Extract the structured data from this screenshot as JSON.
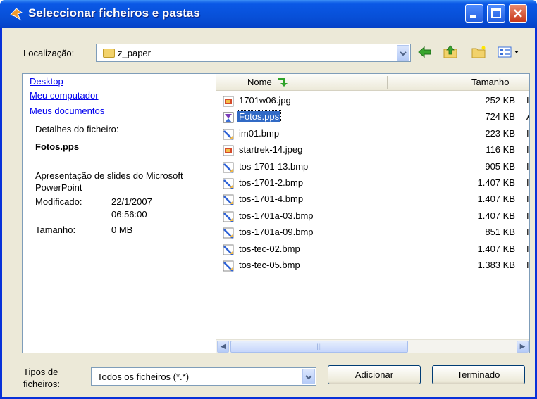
{
  "window": {
    "title": "Seleccionar ficheiros e pastas"
  },
  "location": {
    "label": "Localização:",
    "value": "z_paper"
  },
  "places": [
    "Desktop",
    "Meu computador",
    "Meus documentos"
  ],
  "details": {
    "heading": "Detalhes do ficheiro:",
    "file_name": "Fotos.pps",
    "type_line1": "Apresentação de slides do Microsoft",
    "type_line2": "PowerPoint",
    "modified_label": "Modificado:",
    "modified_date": "22/1/2007",
    "modified_time": "06:56:00",
    "size_label": "Tamanho:",
    "size_value": "0 MB"
  },
  "columns": {
    "name": "Nome",
    "size": "Tamanho"
  },
  "files": [
    {
      "name": "1701w06.jpg",
      "size": "252 KB",
      "extra": "I",
      "icon": "jpg-image-icon"
    },
    {
      "name": "Fotos.pps",
      "size": "724 KB",
      "extra": "A",
      "icon": "pps-presentation-icon",
      "selected": true
    },
    {
      "name": "im01.bmp",
      "size": "223 KB",
      "extra": "I",
      "icon": "bmp-image-icon"
    },
    {
      "name": "startrek-14.jpeg",
      "size": "116 KB",
      "extra": "I",
      "icon": "jpg-image-icon"
    },
    {
      "name": "tos-1701-13.bmp",
      "size": "905 KB",
      "extra": "I",
      "icon": "bmp-image-icon"
    },
    {
      "name": "tos-1701-2.bmp",
      "size": "1.407 KB",
      "extra": "I",
      "icon": "bmp-image-icon"
    },
    {
      "name": "tos-1701-4.bmp",
      "size": "1.407 KB",
      "extra": "I",
      "icon": "bmp-image-icon"
    },
    {
      "name": "tos-1701a-03.bmp",
      "size": "1.407 KB",
      "extra": "I",
      "icon": "bmp-image-icon"
    },
    {
      "name": "tos-1701a-09.bmp",
      "size": "851 KB",
      "extra": "I",
      "icon": "bmp-image-icon"
    },
    {
      "name": "tos-tec-02.bmp",
      "size": "1.407 KB",
      "extra": "I",
      "icon": "bmp-image-icon"
    },
    {
      "name": "tos-tec-05.bmp",
      "size": "1.383 KB",
      "extra": "I",
      "icon": "bmp-image-icon"
    }
  ],
  "filter": {
    "label_line1": "Tipos de",
    "label_line2": "ficheiros:",
    "value": "Todos os ficheiros (*.*)"
  },
  "buttons": {
    "add": "Adicionar",
    "done": "Terminado"
  },
  "colors": {
    "title_bar": "#0a58e6",
    "selection": "#316ac5",
    "link": "#0000ee",
    "dialog_bg": "#ece9d8"
  }
}
